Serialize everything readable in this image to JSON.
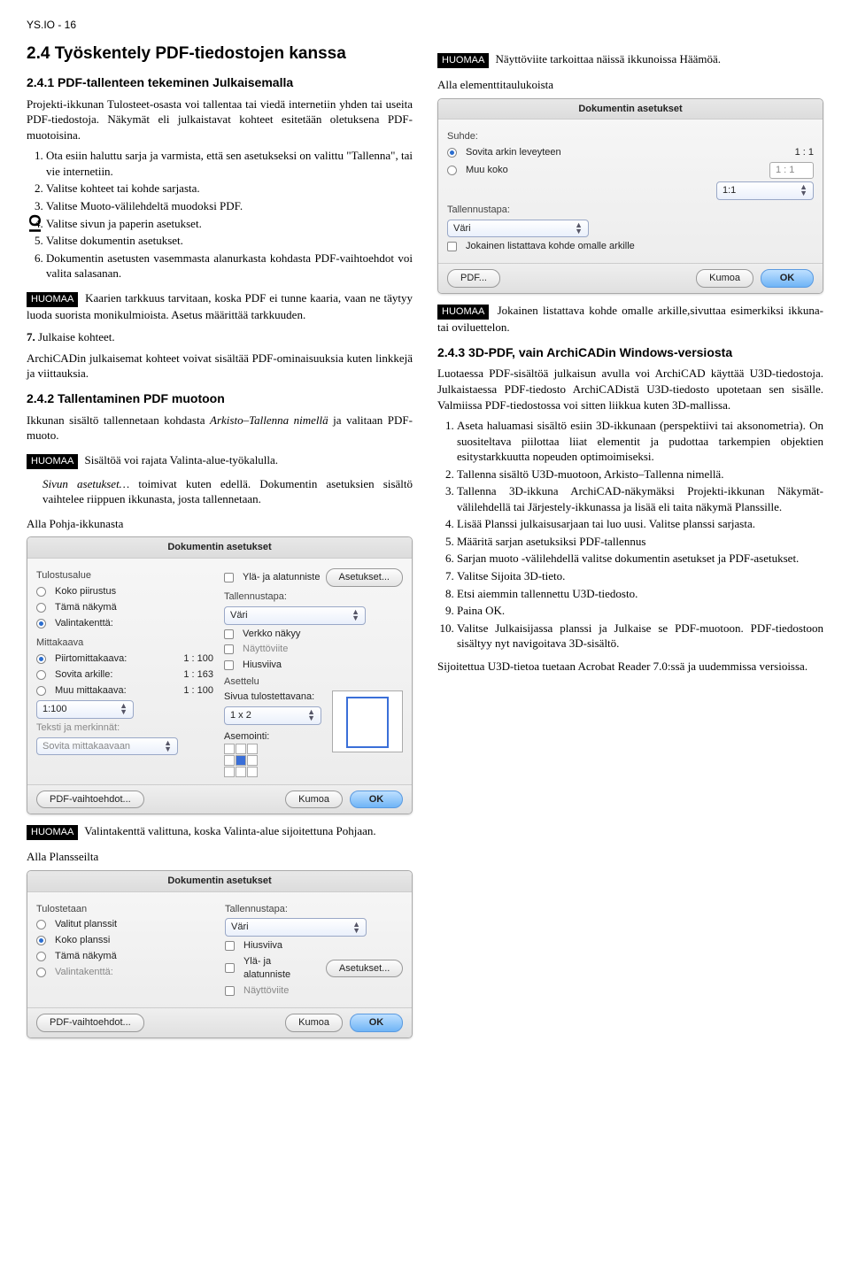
{
  "header": "YS.IO - 16",
  "sidebar_label": "IO",
  "h1": "2.4   Työskentely PDF-tiedostojen kanssa",
  "left": {
    "h2_241": "2.4.1   PDF-tallenteen tekeminen Julkaisemalla",
    "p1": "Projekti-ikkunan Tulosteet-osasta voi tallentaa tai viedä internetiin yhden tai useita PDF-tiedostoja. Näkymät eli julkaistavat kohteet esitetään oletuksena PDF-muotoisina.",
    "ol1": [
      "Ota esiin haluttu sarja ja varmista, että sen asetukseksi on valittu \"Tallenna\", tai vie internetiin.",
      "Valitse kohteet tai kohde sarjasta.",
      "Valitse Muoto-välilehdeltä muodoksi PDF.",
      "Valitse sivun ja paperin asetukset.",
      "Valitse dokumentin asetukset.",
      "Dokumentin asetusten vasemmasta alanurkasta kohdasta PDF-vaihtoehdot voi valita salasanan."
    ],
    "huomaa1": "Kaarien tarkkuus tarvitaan, koska PDF ei tunne kaaria, vaan ne täytyy luoda suorista monikulmioista. Asetus määrittää tarkkuuden.",
    "ol1_after": "7.",
    "ol1_after_text": "Julkaise kohteet.",
    "p_julk": "ArchiCADin julkaisemat kohteet voivat sisältää PDF-ominaisuuksia kuten linkkejä ja viittauksia.",
    "h2_242": "2.4.2   Tallentaminen PDF muotoon",
    "p242a": "Ikkunan sisältö tallennetaan kohdasta ",
    "p242a_italic": "Arkisto–Tallenna nimellä",
    "p242a_end": " ja valitaan PDF-muoto.",
    "huomaa2": "Sisältöä voi rajata Valinta-alue-työkalulla.",
    "p_sivun": "Sivun asetukset…",
    "p_sivun_rest": " toimivat kuten edellä. Dokumentin asetuksien sisältö vaihtelee riippuen ikkunasta, josta tallennetaan.",
    "cap_pohja": "Alla Pohja-ikkunasta",
    "huomaa3": "Valintakenttä valittuna, koska Valinta-alue sijoitettuna Pohjaan.",
    "cap_planssi": "Alla Plansseilta"
  },
  "right": {
    "huomaa4": "Näyttöviite tarkoittaa näissä ikkunoissa Häämöä.",
    "cap_elem": "Alla elementtitaulukoista",
    "huomaa5": "Jokainen listattava kohde omalle arkille,sivuttaa esimerkiksi ikkuna- tai oviluettelon.",
    "h2_243": "2.4.3   3D-PDF, vain ArchiCADin Windows-versiosta",
    "p243a": "Luotaessa PDF-sisältöä julkaisun avulla voi ArchiCAD käyttää U3D-tiedostoja. Julkaistaessa PDF-tiedosto ArchiCADistä U3D-tiedosto upotetaan sen sisälle. Valmiissa PDF-tiedostossa voi sitten liikkua kuten 3D-mallissa.",
    "ol2": [
      "Aseta haluamasi sisältö esiin 3D-ikkunaan (perspektiivi tai aksonometria). On suositeltava piilottaa liiat elementit ja pudottaa tarkempien objektien esitystarkkuutta nopeuden optimoimiseksi.",
      "Tallenna sisältö U3D-muotoon, Arkisto–Tallenna nimellä.",
      "Tallenna 3D-ikkuna ArchiCAD-näkymäksi Projekti-ikkunan Näkymät-välilehdellä tai Järjestely-ikkunassa ja lisää eli taita näkymä Planssille.",
      "Lisää Planssi julkaisusarjaan tai luo uusi. Valitse planssi sarjasta.",
      "Määritä sarjan asetuksiksi PDF-tallennus",
      "Sarjan muoto -välilehdellä valitse dokumentin asetukset ja PDF-asetukset.",
      "Valitse Sijoita 3D-tieto.",
      "Etsi aiemmin tallennettu U3D-tiedosto.",
      "Paina OK.",
      "Valitse Julkaisijassa planssi ja Julkaise se PDF-muotoon. PDF-tiedostoon sisältyy nyt navigoitava 3D-sisältö."
    ],
    "p_end": "Sijoitettua U3D-tietoa tuetaan Acrobat Reader 7.0:ssä ja uudemmissa versioissa."
  },
  "labels": {
    "huomaa": "HUOMAA"
  },
  "dlg1": {
    "title": "Dokumentin asetukset",
    "tulostusalue": "Tulostusalue",
    "koko": "Koko piirustus",
    "tama": "Tämä näkymä",
    "valinta": "Valintakenttä:",
    "mittakaava": "Mittakaava",
    "piirto": "Piirtomittakaava:",
    "piirto_v": "1 : 100",
    "sovita": "Sovita arkille:",
    "sovita_v": "1 : 163",
    "muu": "Muu mittakaava:",
    "muu_v": "1 : 100",
    "zoom": "1:100",
    "teksti": "Teksti ja merkinnät:",
    "teksti_v": "Sovita mittakaavaan",
    "yla": "Ylä- ja alatunniste",
    "aset_btn": "Asetukset...",
    "tallennustapa": "Tallennustapa:",
    "vari": "Väri",
    "verkko": "Verkko näkyy",
    "naytto": "Näyttöviite",
    "hius": "Hiusviiva",
    "asettelu": "Asettelu",
    "sivua": "Sivua tulostettavana:",
    "sivua_v": "1 x 2",
    "asem": "Asemointi:",
    "pdfbtn": "PDF-vaihtoehdot...",
    "kumoa": "Kumoa",
    "ok": "OK"
  },
  "dlg2": {
    "title": "Dokumentin asetukset",
    "tulostetaan": "Tulostetaan",
    "valitut": "Valitut planssit",
    "koko": "Koko planssi",
    "tama": "Tämä näkymä",
    "valinta": "Valintakenttä:",
    "tallennustapa": "Tallennustapa:",
    "vari": "Väri",
    "hius": "Hiusviiva",
    "yla": "Ylä- ja alatunniste",
    "aset_btn": "Asetukset...",
    "naytto": "Näyttöviite",
    "pdfbtn": "PDF-vaihtoehdot...",
    "kumoa": "Kumoa",
    "ok": "OK"
  },
  "dlg3": {
    "title": "Dokumentin asetukset",
    "suhde": "Suhde:",
    "sovita": "Sovita arkin leveyteen",
    "sovita_v": "1 : 1",
    "muu": "Muu koko",
    "muu_v": "1 : 1",
    "zoom": "1:1",
    "tallennustapa": "Tallennustapa:",
    "vari": "Väri",
    "jok": "Jokainen listattava kohde omalle arkille",
    "pdfbtn": "PDF...",
    "kumoa": "Kumoa",
    "ok": "OK"
  }
}
